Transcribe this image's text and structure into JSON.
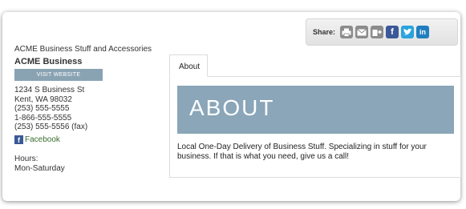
{
  "share": {
    "label": "Share:",
    "icons": [
      "print-icon",
      "email-icon",
      "save-icon",
      "facebook-icon",
      "twitter-icon",
      "linkedin-icon"
    ],
    "colors": {
      "facebook": "#3b5998",
      "twitter": "#2aa3dd",
      "linkedin": "#1f7fc1"
    }
  },
  "business": {
    "full_name": "ACME Business Stuff and Accessories",
    "name": "ACME Business",
    "visit_label": "VISIT WEBSITE",
    "address1": "1234 S Business St",
    "address2": "Kent, WA 98032",
    "phone1": "(253) 555-5555",
    "phone2": "1-866-555-5555",
    "fax": "(253) 555-5556 (fax)",
    "facebook_label": "Facebook",
    "hours_label": "Hours:",
    "hours_value": "Mon-Saturday"
  },
  "tabs": [
    {
      "label": "About"
    }
  ],
  "about": {
    "heading": "ABOUT",
    "banner_color": "#8aa6b8",
    "description": "Local One-Day Delivery of Business Stuff. Specializing in stuff for your business. If that is what you need, give us a call!"
  }
}
